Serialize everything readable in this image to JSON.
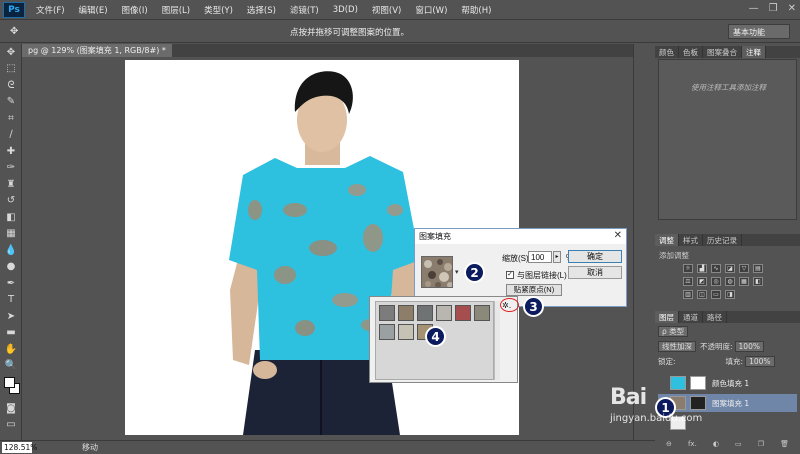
{
  "app": {
    "logo": "Ps",
    "menu": [
      "文件(F)",
      "编辑(E)",
      "图像(I)",
      "图层(L)",
      "类型(Y)",
      "选择(S)",
      "滤镜(T)",
      "3D(D)",
      "视图(V)",
      "窗口(W)",
      "帮助(H)"
    ],
    "window_controls": [
      "—",
      "❐",
      "✕"
    ]
  },
  "options_bar": {
    "tool_glyph": "✥",
    "hint": "点按并拖移可调整图案的位置。",
    "workspace": "基本功能"
  },
  "document": {
    "tab_label": "pg @ 129% (图案填充 1, RGB/8#) *"
  },
  "status_bar": {
    "zoom": "128.51%",
    "text": "移动"
  },
  "dialog": {
    "title": "图案填充",
    "close": "✕",
    "scale_label": "缩放(S):",
    "scale_value": "100",
    "scale_unit": "%",
    "link_label": "与图层链接(L)",
    "link_checked": "✓",
    "snap_button": "贴紧原点(N)",
    "ok_button": "确定",
    "cancel_button": "取消"
  },
  "pattern_picker": {
    "gear": "✲."
  },
  "callouts": [
    "2",
    "3",
    "4",
    "1"
  ],
  "right_panels": {
    "top_tabs": [
      "颜色",
      "色板",
      "图案叠合",
      "注释"
    ],
    "notes_hint": "使用注释工具添加注释",
    "mid_tabs": [
      "调整",
      "样式",
      "历史记录"
    ],
    "adj_label": "添加调整",
    "layer_tabs": [
      "图层",
      "通道",
      "路径"
    ],
    "kind_filter": "ρ 类型",
    "blend_mode": "线性加深",
    "opacity_label": "不透明度:",
    "opacity_value": "100%",
    "lock_label": "锁定:",
    "fill_label": "填充:",
    "fill_value": "100%",
    "layers": [
      {
        "name": "颜色填充 1"
      },
      {
        "name": "图案填充 1"
      },
      {
        "name": ""
      }
    ],
    "footer_icons": [
      "⊖",
      "fx.",
      "◐",
      "▭",
      "❐",
      "🗑"
    ]
  },
  "watermark": {
    "line1": "Bai",
    "line2": "jingyan.baidu.com"
  },
  "colors": {
    "shirt": "#2ec0df",
    "dialog_border": "#7a9cc6",
    "callout": "#0c1a5e",
    "highlight_ring": "#e02020"
  }
}
